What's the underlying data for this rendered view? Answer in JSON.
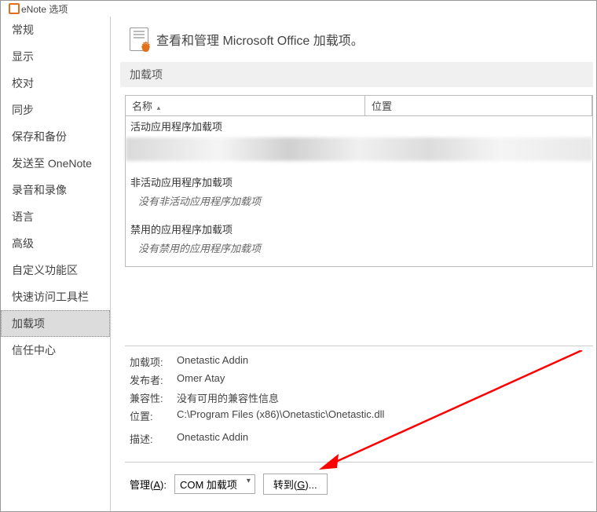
{
  "window": {
    "title": "eNote 选项"
  },
  "sidebar": {
    "items": [
      {
        "label": "常规"
      },
      {
        "label": "显示"
      },
      {
        "label": "校对"
      },
      {
        "label": "同步"
      },
      {
        "label": "保存和备份"
      },
      {
        "label": "发送至 OneNote"
      },
      {
        "label": "录音和录像"
      },
      {
        "label": "语言"
      },
      {
        "label": "高级"
      },
      {
        "label": "自定义功能区"
      },
      {
        "label": "快速访问工具栏"
      },
      {
        "label": "加载项"
      },
      {
        "label": "信任中心"
      }
    ],
    "selected_index": 11
  },
  "header": {
    "text": "查看和管理 Microsoft Office 加载项。"
  },
  "section": {
    "label": "加载项"
  },
  "table": {
    "columns": {
      "name": "名称",
      "location": "位置"
    },
    "sort_indicator": "▴",
    "groups": [
      {
        "title": "活动应用程序加载项",
        "blurred": true
      },
      {
        "title": "非活动应用程序加载项",
        "empty_text": "没有非活动应用程序加载项"
      },
      {
        "title": "禁用的应用程序加载项",
        "empty_text": "没有禁用的应用程序加载项"
      }
    ]
  },
  "details": {
    "rows": [
      {
        "label": "加载项:",
        "value": "Onetastic Addin"
      },
      {
        "label": "发布者:",
        "value": "Omer Atay"
      },
      {
        "label": "兼容性:",
        "value": "没有可用的兼容性信息"
      },
      {
        "label": "位置:",
        "value": "C:\\Program Files (x86)\\Onetastic\\Onetastic.dll"
      }
    ],
    "desc_label": "描述:",
    "desc_value": "Onetastic Addin"
  },
  "manage": {
    "label_pre": "管理(",
    "label_hotkey": "A",
    "label_post": "):",
    "dropdown_value": "COM 加载项",
    "button_pre": "转到(",
    "button_hotkey": "G",
    "button_post": ")..."
  }
}
